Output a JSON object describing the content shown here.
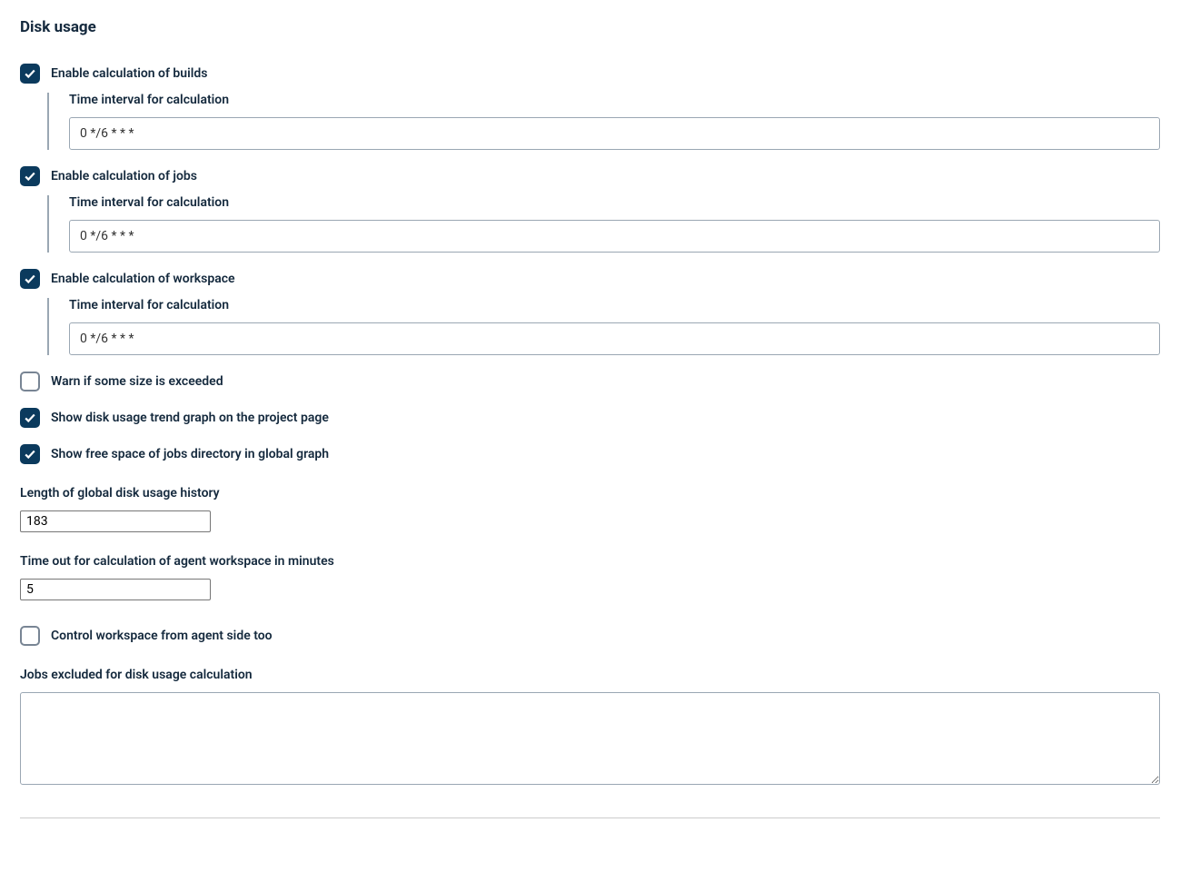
{
  "title": "Disk usage",
  "builds": {
    "enable_label": "Enable calculation of builds",
    "interval_label": "Time interval for calculation",
    "interval_value": "0 */6 * * *"
  },
  "jobs": {
    "enable_label": "Enable calculation of jobs",
    "interval_label": "Time interval for calculation",
    "interval_value": "0 */6 * * *"
  },
  "workspace": {
    "enable_label": "Enable calculation of workspace",
    "interval_label": "Time interval for calculation",
    "interval_value": "0 */6 * * *"
  },
  "warn_label": "Warn if some size is exceeded",
  "trend_label": "Show disk usage trend graph on the project page",
  "freespace_label": "Show free space of jobs directory in global graph",
  "history": {
    "label": "Length of global disk usage history",
    "value": "183"
  },
  "timeout": {
    "label": "Time out for calculation of agent workspace in minutes",
    "value": "5"
  },
  "agent_control_label": "Control workspace from agent side too",
  "excluded": {
    "label": "Jobs excluded for disk usage calculation",
    "value": ""
  }
}
